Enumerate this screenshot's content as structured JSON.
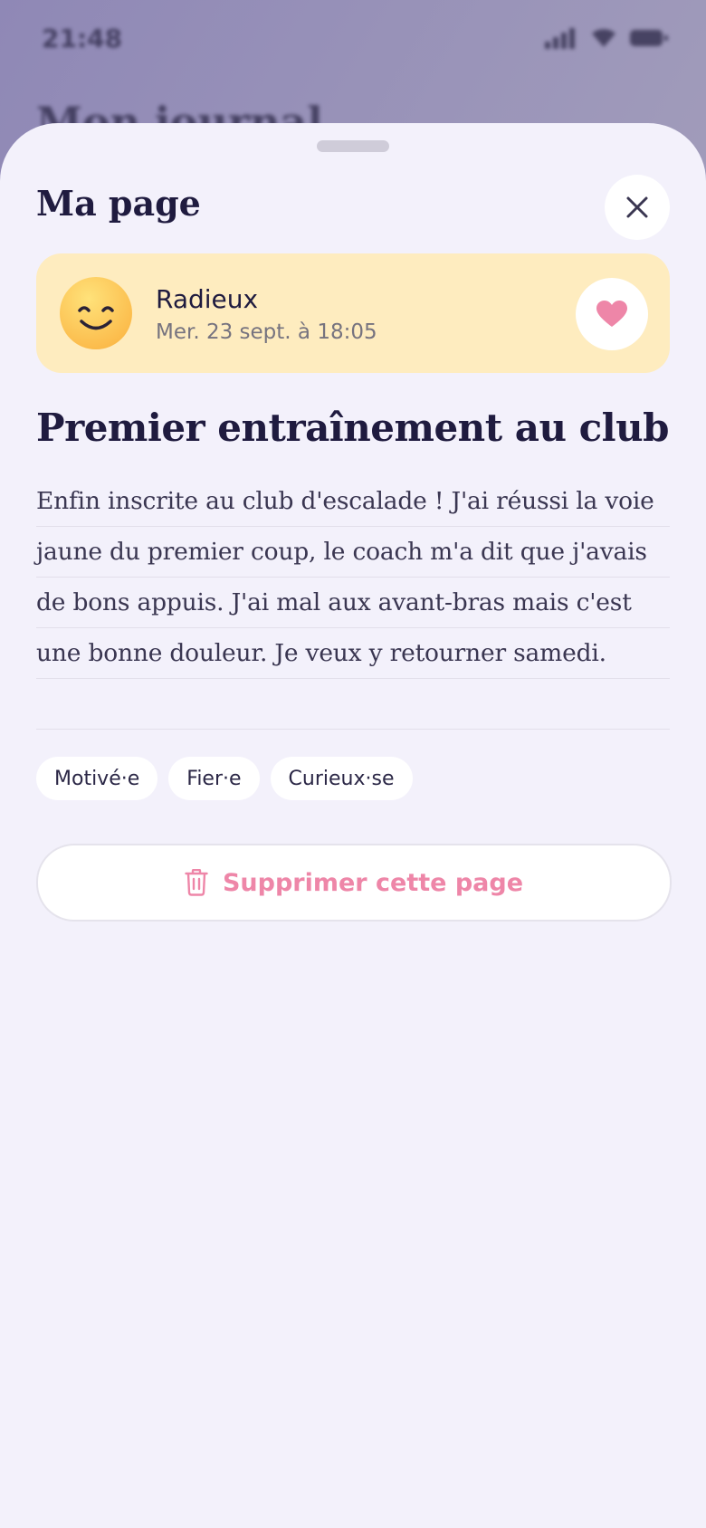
{
  "status_bar": {
    "time": "21:48"
  },
  "background": {
    "title": "Mon journal"
  },
  "sheet": {
    "title": "Ma page"
  },
  "mood": {
    "name": "Radieux",
    "date": "Mer. 23 sept. à 18:05",
    "icon": "smiling-face-icon",
    "favorite_icon": "heart-icon"
  },
  "entry": {
    "title": "Premier entraînement au club",
    "body": "Enfin inscrite au club d'escalade ! J'ai réussi la voie jaune du premier coup, le coach m'a dit que j'avais de bons appuis. J'ai mal aux avant-bras mais c'est une bonne douleur. Je veux y retourner samedi."
  },
  "tags": [
    "Motivé·e",
    "Fier·e",
    "Curieux·se"
  ],
  "actions": {
    "delete_label": "Supprimer cette page",
    "delete_icon": "trash-icon",
    "close_icon": "close-icon"
  },
  "colors": {
    "accent_pink": "#ee86a8",
    "mood_card": "#feecbf",
    "sheet_background": "#f3f1fb",
    "title_text": "#1f1b3f"
  }
}
